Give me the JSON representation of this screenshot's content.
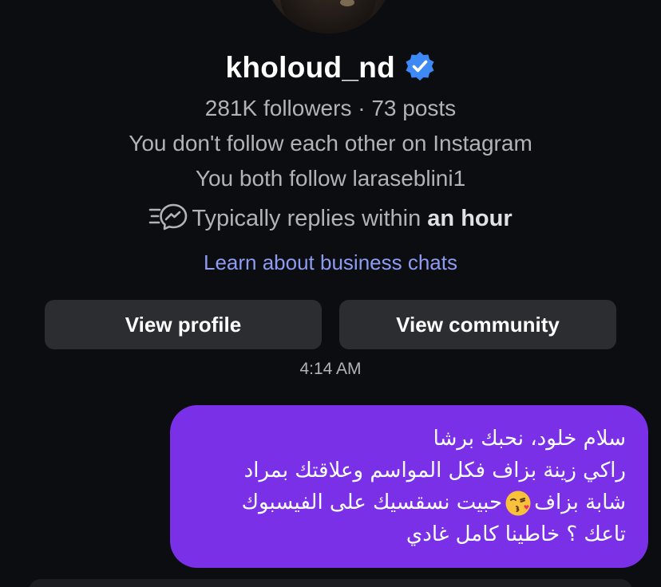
{
  "profile": {
    "username": "kholoud_nd",
    "stats": "281K followers · 73 posts",
    "follow_status": "You don't follow each other on Instagram",
    "mutual": "You both follow laraseblini1",
    "reply_prefix": "Typically replies within ",
    "reply_time": "an hour",
    "learn_link": "Learn about business chats"
  },
  "buttons": {
    "view_profile": "View profile",
    "view_community": "View community"
  },
  "chat": {
    "timestamp": "4:14 AM",
    "message": {
      "line1": "سلام خلود، نحبك برشا",
      "line2": "راكي زينة بزاف فكل المواسم وعلاقتك بمراد",
      "line3_a": "شابة بزاف",
      "line3_b": "حبيت نسقسيك على الفيسبوك",
      "line4": "تاعك ؟ خاطينا كامل غادي"
    }
  },
  "icons": {
    "verified": "verified-badge-icon",
    "reply_speed": "messenger-speed-icon",
    "emoji": "kissing-face-emoji"
  },
  "colors": {
    "background": "#0c0d10",
    "bubble": "#7a30e6",
    "link": "#8e9bf3",
    "verified": "#3d8af7",
    "button": "#2c2d31"
  }
}
